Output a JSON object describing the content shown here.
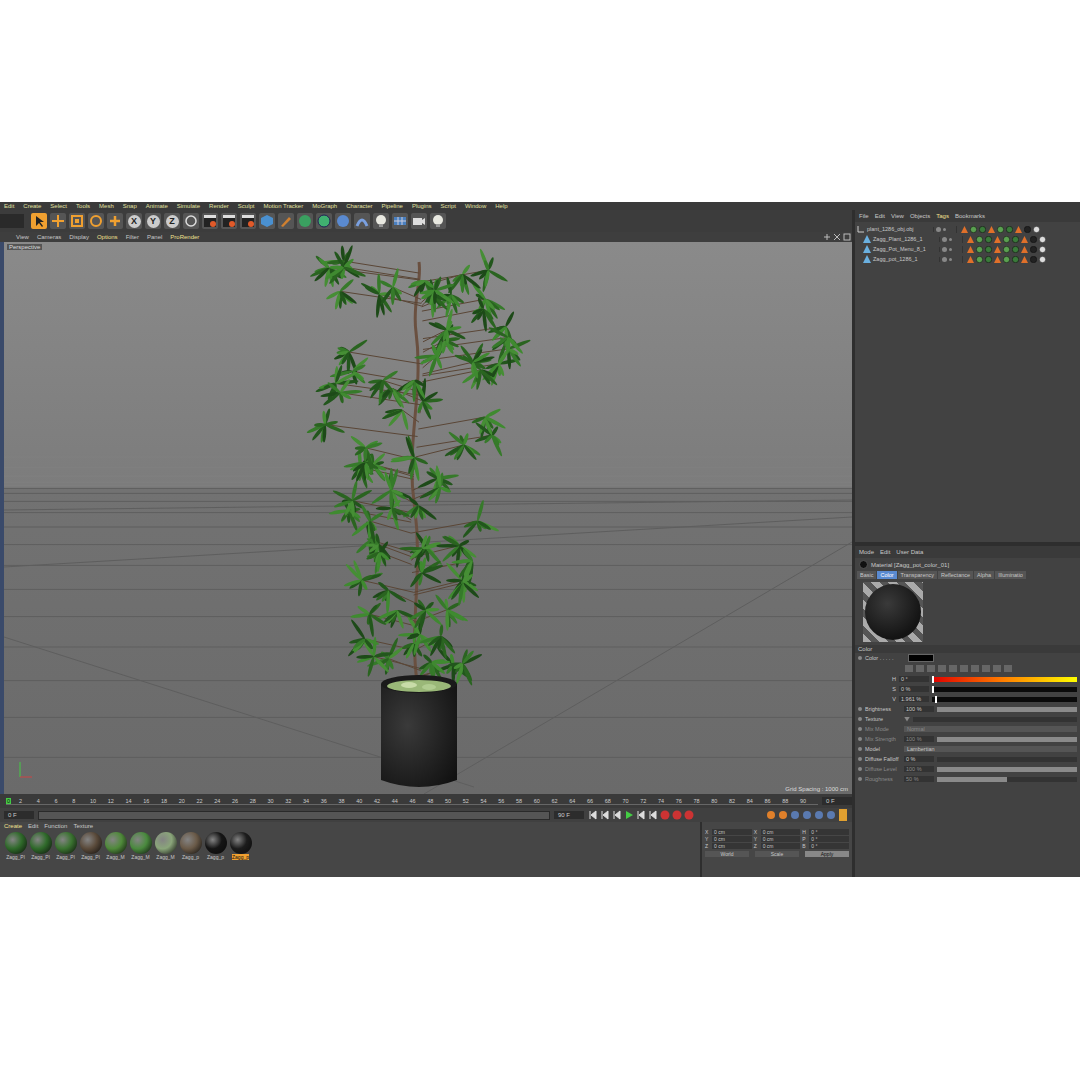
{
  "menubar": [
    "Edit",
    "Create",
    "Select",
    "Tools",
    "Mesh",
    "Snap",
    "Animate",
    "Simulate",
    "Render",
    "Sculpt",
    "Motion Tracker",
    "MoGraph",
    "Character",
    "Pipeline",
    "Plugins",
    "Script",
    "Window",
    "Help"
  ],
  "toolbar": {
    "axis_buttons": [
      "X",
      "Y",
      "Z"
    ]
  },
  "viewport": {
    "menu": [
      "View",
      "Cameras",
      "Display",
      "Options",
      "Filter",
      "Panel",
      "ProRender"
    ],
    "camera": "Perspective",
    "grid_spacing": "Grid Spacing : 1000 cm"
  },
  "timeline": {
    "ticks": [
      "0",
      "2",
      "4",
      "6",
      "8",
      "10",
      "12",
      "14",
      "16",
      "18",
      "20",
      "22",
      "24",
      "26",
      "28",
      "30",
      "32",
      "34",
      "36",
      "38",
      "40",
      "42",
      "44",
      "46",
      "48",
      "50",
      "52",
      "54",
      "56",
      "58",
      "60",
      "62",
      "64",
      "66",
      "68",
      "70",
      "72",
      "74",
      "76",
      "78",
      "80",
      "82",
      "84",
      "86",
      "88",
      "90"
    ],
    "playhead": 0,
    "end_field": "0 F"
  },
  "transport": {
    "current": "0 F",
    "end": "90 F"
  },
  "material_manager": {
    "menu": [
      "Create",
      "Edit",
      "Function",
      "Texture"
    ],
    "materials": [
      {
        "name": "Zagg_Pl",
        "color": "#2f6a2a",
        "selected": false
      },
      {
        "name": "Zagg_Pl",
        "color": "#2f6a2a",
        "selected": false
      },
      {
        "name": "Zagg_Pl",
        "color": "#3a7330",
        "selected": false
      },
      {
        "name": "Zagg_Pl",
        "color": "#5a4a3a",
        "selected": false
      },
      {
        "name": "Zagg_M",
        "color": "#4f8a3a",
        "selected": false
      },
      {
        "name": "Zagg_M",
        "color": "#4a8a3e",
        "selected": false
      },
      {
        "name": "Zagg_M",
        "color": "#8aa57a",
        "selected": false
      },
      {
        "name": "Zagg_p",
        "color": "#6a5a48",
        "selected": false
      },
      {
        "name": "Zagg_p",
        "color": "#151515",
        "selected": false
      },
      {
        "name": "Zagg_p",
        "color": "#1c1c1c",
        "selected": true
      }
    ]
  },
  "coordinates": {
    "rows": [
      {
        "pos_axis": "X",
        "pos": "0 cm",
        "size_axis": "X",
        "size": "0 cm",
        "rot_axis": "H",
        "rot": "0 °"
      },
      {
        "pos_axis": "Y",
        "pos": "0 cm",
        "size_axis": "Y",
        "size": "0 cm",
        "rot_axis": "P",
        "rot": "0 °"
      },
      {
        "pos_axis": "Z",
        "pos": "0 cm",
        "size_axis": "Z",
        "size": "0 cm",
        "rot_axis": "B",
        "rot": "0 °"
      }
    ],
    "buttons": [
      "World",
      "Scale",
      "Apply"
    ]
  },
  "object_manager": {
    "menu": [
      "File",
      "Edit",
      "View",
      "Objects",
      "Tags",
      "Bookmarks"
    ],
    "objects": [
      {
        "name": "plant_1286_obj.obj",
        "kind": "group"
      },
      {
        "name": "Zagg_Plant_1286_1",
        "kind": "mesh"
      },
      {
        "name": "Zagg_Pot_Menu_8_1",
        "kind": "mesh"
      },
      {
        "name": "Zagg_pot_1286_1",
        "kind": "mesh"
      }
    ]
  },
  "attribute_manager": {
    "menu": [
      "Mode",
      "Edit",
      "User Data"
    ],
    "title": "Material [Zagg_pot_color_01]",
    "tabs": [
      {
        "label": "Basic",
        "selected": false
      },
      {
        "label": "Color",
        "selected": true
      },
      {
        "label": "Transparency",
        "selected": false
      },
      {
        "label": "Reflectance",
        "selected": false
      },
      {
        "label": "Alpha",
        "selected": false
      },
      {
        "label": "Illuminatio",
        "selected": false
      }
    ],
    "section": "Color",
    "color_label": "Color . . . . .",
    "color_value": "#000000",
    "hsv": [
      {
        "label": "H",
        "value": "0 °",
        "level": 0
      },
      {
        "label": "S",
        "value": "0 %",
        "level": 0
      },
      {
        "label": "V",
        "value": "1.961 %",
        "level": 0.0196
      }
    ],
    "params": [
      {
        "label": "Brightness",
        "kind": "slider",
        "value": "100 %",
        "level": 1,
        "disabled": false
      },
      {
        "label": "Texture",
        "kind": "texture",
        "disabled": false
      },
      {
        "label": "Mix Mode",
        "kind": "dropdown",
        "value": "Normal",
        "disabled": true
      },
      {
        "label": "Mix Strength",
        "kind": "slider",
        "value": "100 %",
        "level": 1,
        "disabled": true
      },
      {
        "label": "Model",
        "kind": "dropdown",
        "value": "Lambertian",
        "disabled": false
      },
      {
        "label": "Diffuse Falloff",
        "kind": "slider",
        "value": "0 %",
        "level": 0,
        "disabled": false
      },
      {
        "label": "Diffuse Level",
        "kind": "slider",
        "value": "100 %",
        "level": 1,
        "disabled": true
      },
      {
        "label": "Roughness",
        "kind": "slider",
        "value": "50 %",
        "level": 0.5,
        "disabled": true
      }
    ]
  }
}
